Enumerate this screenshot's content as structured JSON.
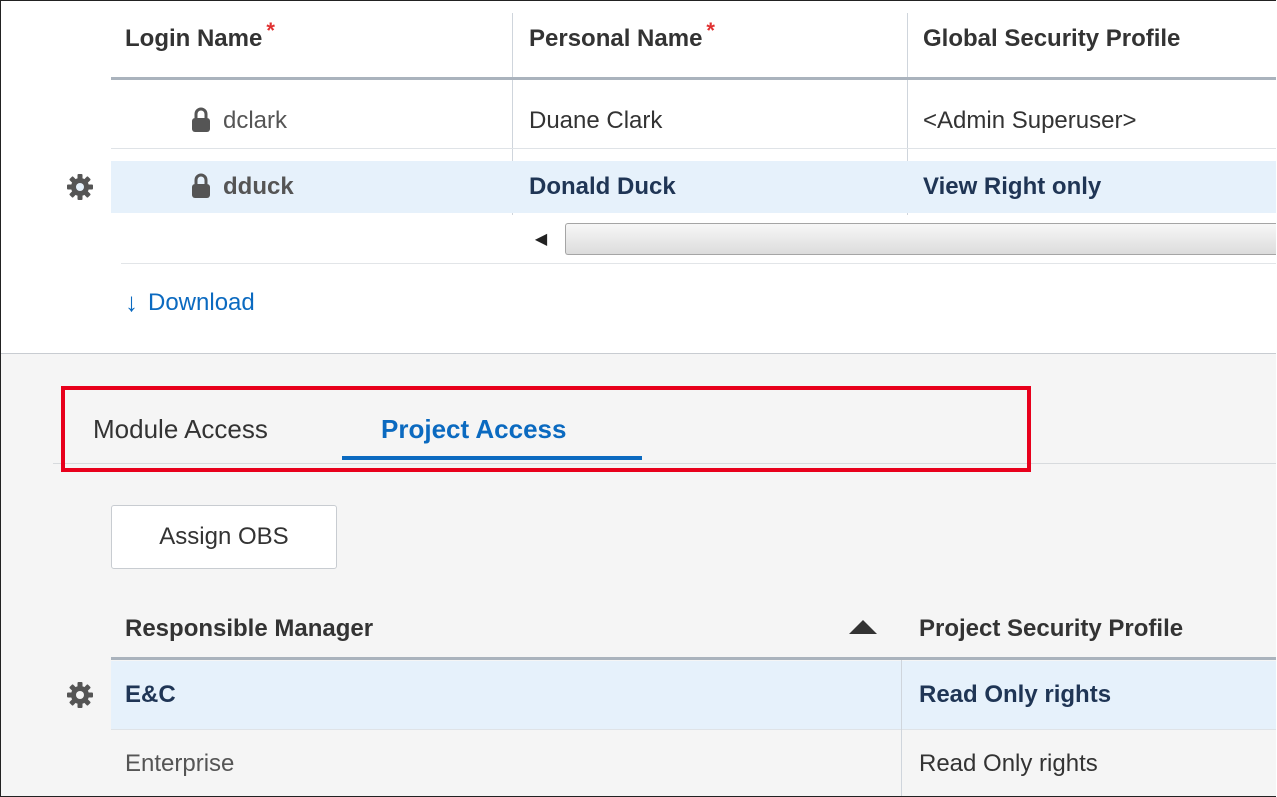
{
  "users_table": {
    "columns": [
      {
        "label": "Login Name",
        "required_mark": "*"
      },
      {
        "label": "Personal Name",
        "required_mark": "*"
      },
      {
        "label": "Global Security Profile",
        "required_mark": ""
      }
    ],
    "rows": [
      {
        "login": "dclark",
        "name": "Duane Clark",
        "profile": "<Admin Superuser>",
        "selected": false
      },
      {
        "login": "dduck",
        "name": "Donald Duck",
        "profile": "View Right only",
        "selected": true
      }
    ]
  },
  "download_link": {
    "arrow": "↓",
    "label": "Download"
  },
  "tabs": [
    {
      "label": "Module Access",
      "active": false
    },
    {
      "label": "Project Access",
      "active": true
    }
  ],
  "assign_button": {
    "label": "Assign OBS"
  },
  "obs_table": {
    "columns": [
      "Responsible Manager",
      "Project Security Profile"
    ],
    "rows": [
      {
        "manager": "E&C",
        "profile": "Read Only rights",
        "selected": true
      },
      {
        "manager": "Enterprise",
        "profile": "Read Only rights",
        "selected": false
      }
    ]
  },
  "colors": {
    "accent": "#0b6ac0",
    "selection": "#e6f1fb",
    "highlight_box": "#e8001c",
    "required": "#e03131"
  }
}
